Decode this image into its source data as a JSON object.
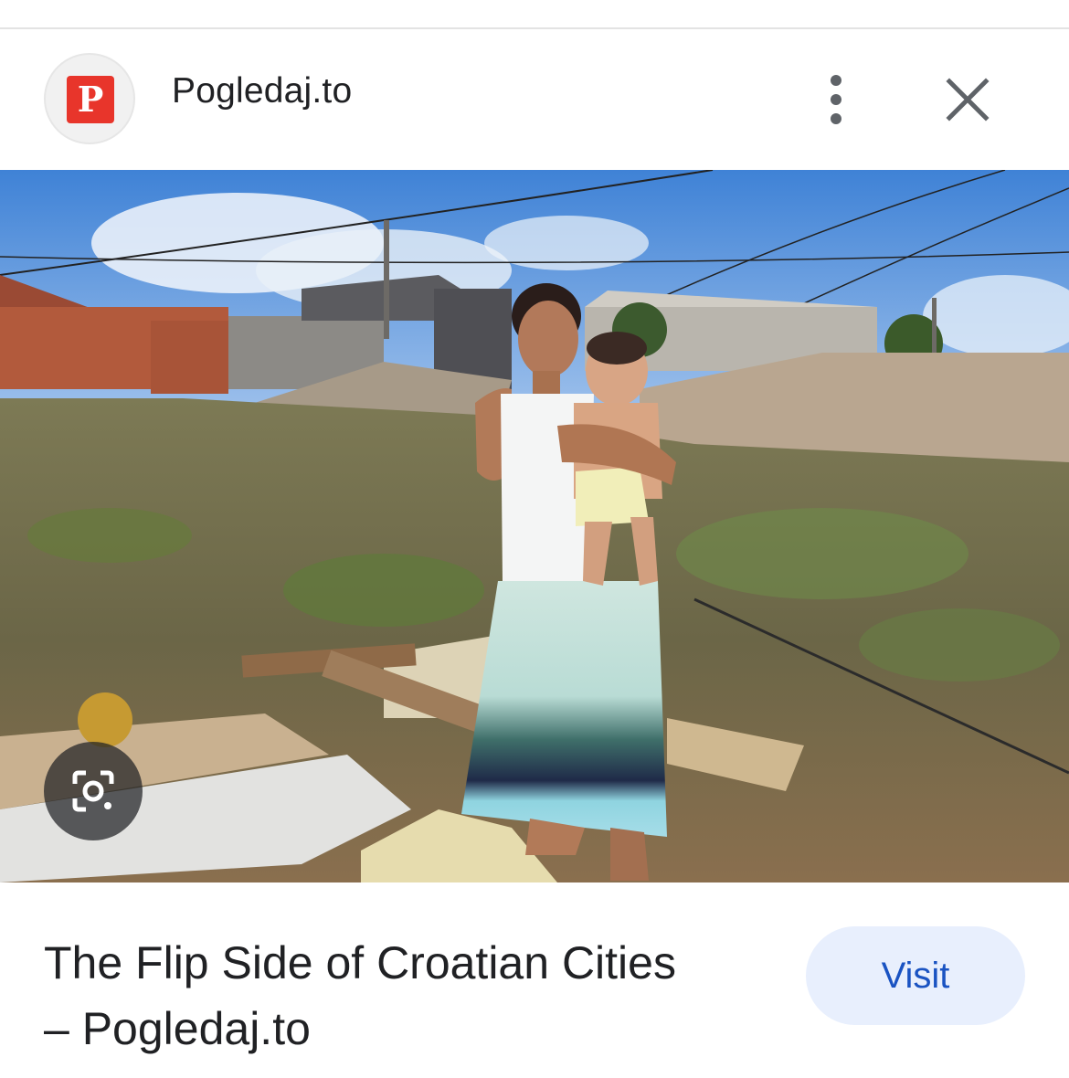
{
  "header": {
    "favicon_letter": "P",
    "site_name": "Pogledaj.to",
    "more_icon": "more-vert-icon",
    "close_icon": "close-icon"
  },
  "image": {
    "lens_icon": "lens-search-icon"
  },
  "result": {
    "title_line1": "The Flip Side of Croatian Cities",
    "title_line2": "– Pogledaj.to",
    "visit_label": "Visit"
  },
  "colors": {
    "favicon_bg": "#e8352b",
    "visit_bg": "#e8effd",
    "visit_text": "#1a53c2",
    "text": "#202124"
  }
}
